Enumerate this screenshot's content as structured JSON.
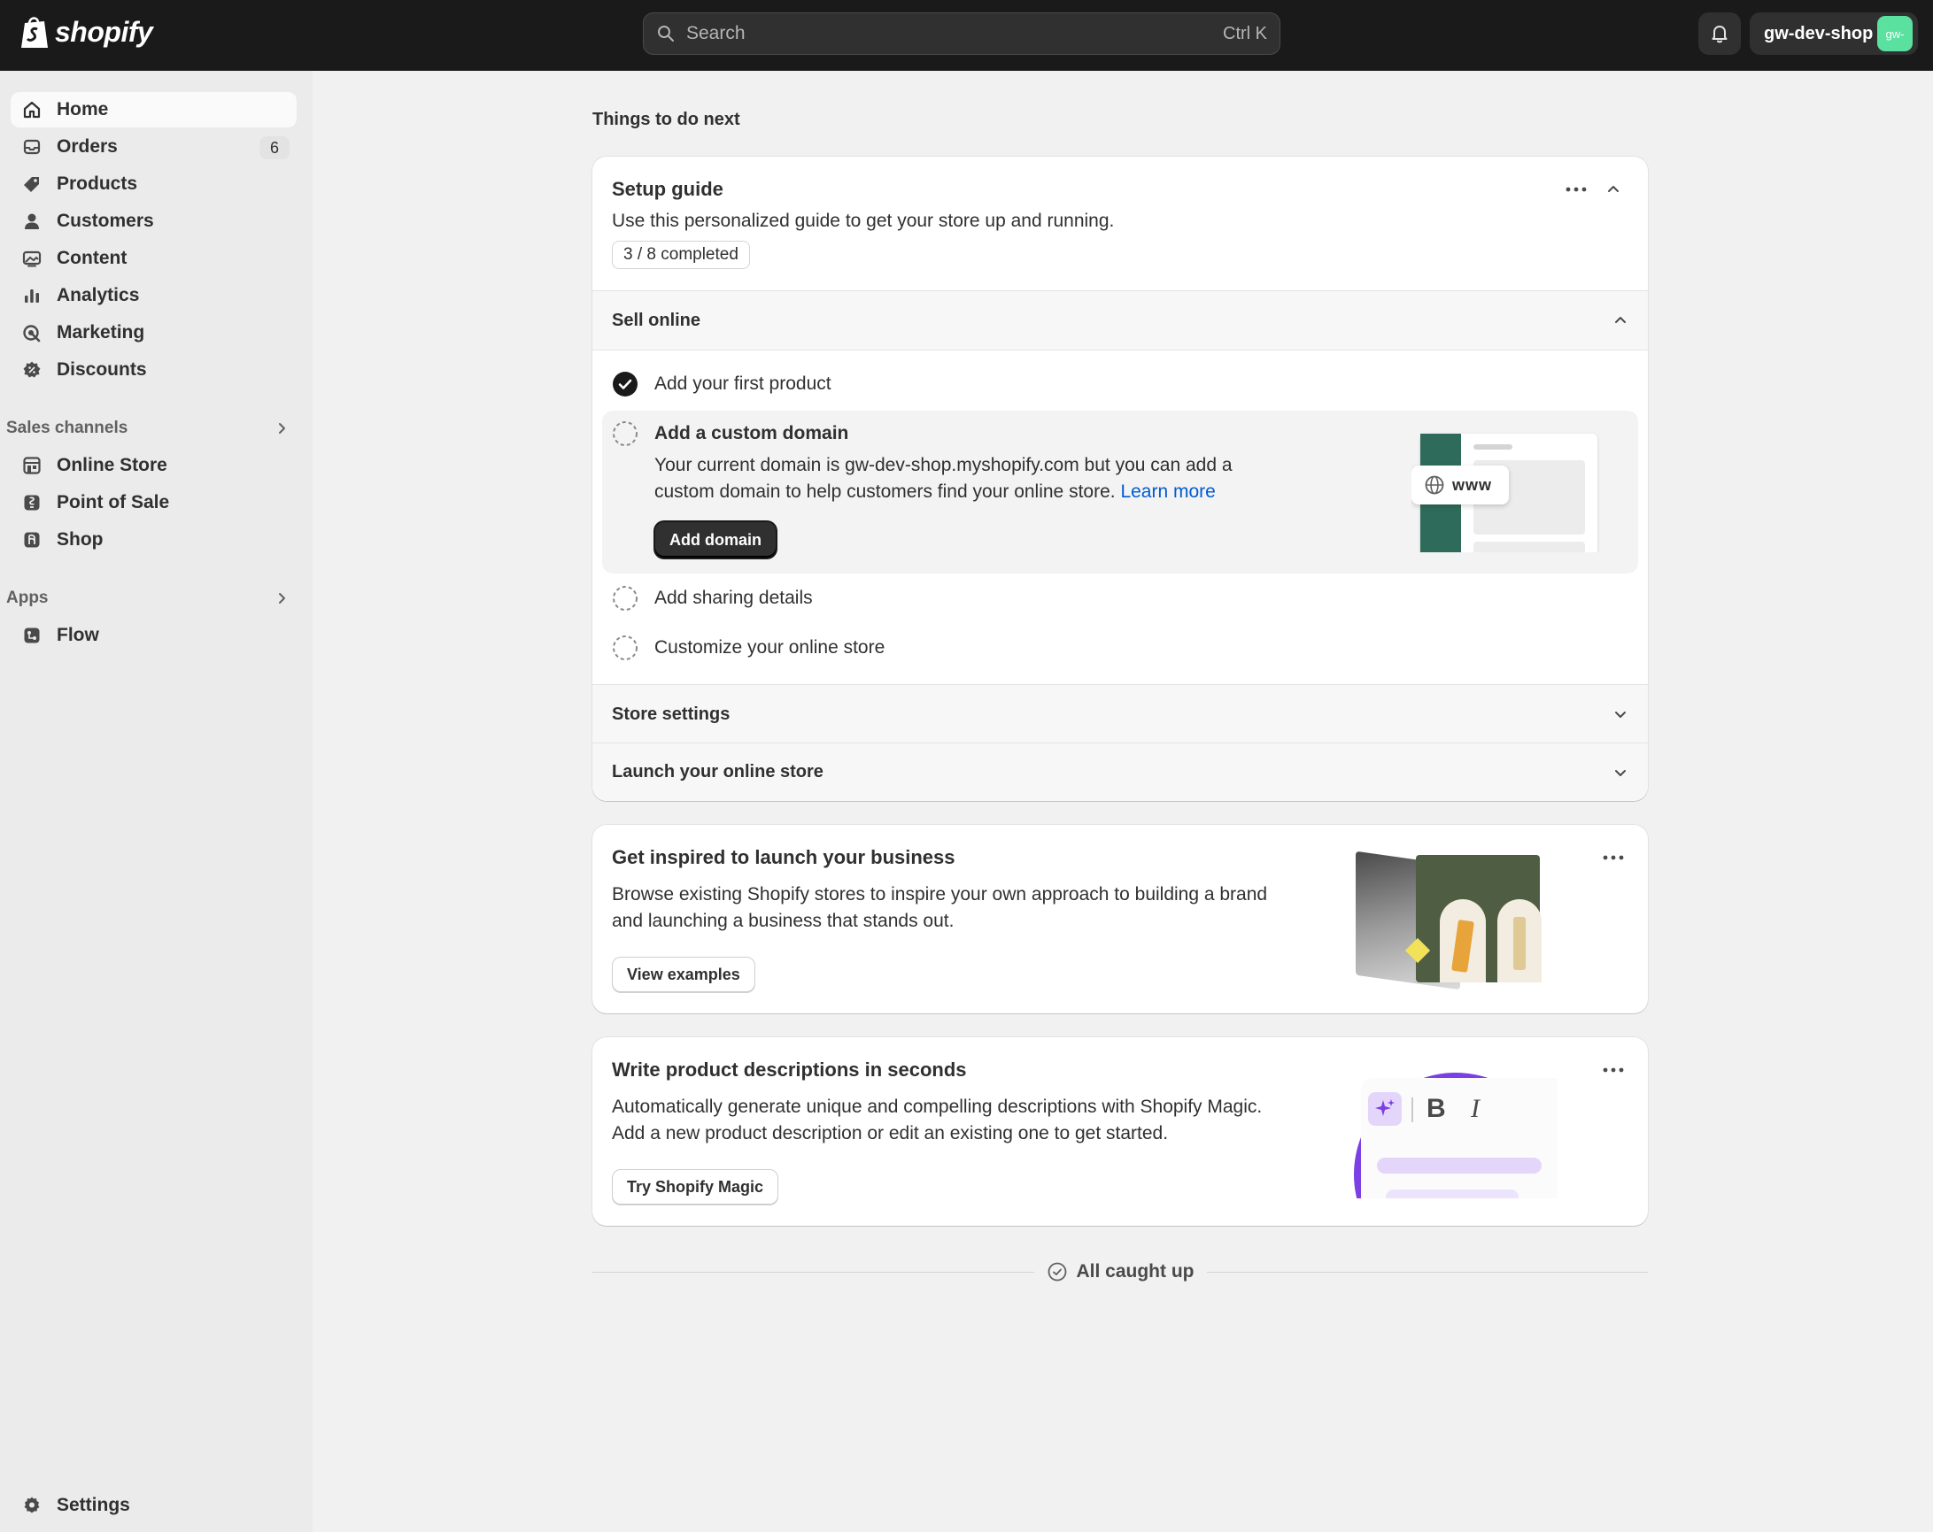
{
  "topbar": {
    "logo_text": "shopify",
    "search_placeholder": "Search",
    "search_shortcut": "Ctrl K",
    "store_name": "gw-dev-shop",
    "avatar_text": "gw-"
  },
  "sidebar": {
    "items": [
      {
        "label": "Home",
        "icon": "home-icon",
        "active": true
      },
      {
        "label": "Orders",
        "icon": "inbox-icon",
        "badge": "6"
      },
      {
        "label": "Products",
        "icon": "tag-icon"
      },
      {
        "label": "Customers",
        "icon": "person-icon"
      },
      {
        "label": "Content",
        "icon": "image-icon"
      },
      {
        "label": "Analytics",
        "icon": "bar-chart-icon"
      },
      {
        "label": "Marketing",
        "icon": "target-icon"
      },
      {
        "label": "Discounts",
        "icon": "discount-icon"
      }
    ],
    "sales_channels_label": "Sales channels",
    "sales_channels": [
      {
        "label": "Online Store",
        "icon": "storefront-icon"
      },
      {
        "label": "Point of Sale",
        "icon": "pos-icon"
      },
      {
        "label": "Shop",
        "icon": "shop-icon"
      }
    ],
    "apps_label": "Apps",
    "apps": [
      {
        "label": "Flow",
        "icon": "flow-icon"
      }
    ],
    "settings_label": "Settings"
  },
  "main": {
    "title": "Things to do next",
    "setup_guide": {
      "title": "Setup guide",
      "description": "Use this personalized guide to get your store up and running.",
      "progress_label": "3 / 8 completed",
      "progress": {
        "completed": 3,
        "total": 8
      },
      "sections": {
        "sell_online": "Sell online",
        "store_settings": "Store settings",
        "launch": "Launch your online store"
      },
      "tasks": [
        {
          "label": "Add your first product",
          "done": true
        },
        {
          "label": "Add a custom domain",
          "done": false
        },
        {
          "label": "Add sharing details",
          "done": false
        },
        {
          "label": "Customize your online store",
          "done": false
        }
      ],
      "domain_text_1": "Your current domain is gw-dev-shop.myshopify.com but you can add a",
      "domain_text_2": "custom domain to help customers find your online store.",
      "learn_more": "Learn more",
      "add_domain_button": "Add domain",
      "www_label": "www"
    },
    "inspire_card": {
      "title": "Get inspired to launch your business",
      "line1": "Browse existing Shopify stores to inspire your own approach to building a brand",
      "line2": "and launching a business that stands out.",
      "button": "View examples"
    },
    "magic_card": {
      "title": "Write product descriptions in seconds",
      "line1": "Automatically generate unique and compelling descriptions with Shopify Magic.",
      "line2": "Add a new product description or edit an existing one to get started.",
      "button": "Try Shopify Magic",
      "bold_glyph": "B",
      "italic_glyph": "I"
    },
    "all_caught_up": "All caught up"
  },
  "colors": {
    "topbar": "#1a1a1a",
    "sidebar": "#ebebeb",
    "page": "#f1f1f1",
    "link": "#005bd3",
    "avatar": "#5be19f",
    "magic_purple": "#7b3fe4"
  }
}
